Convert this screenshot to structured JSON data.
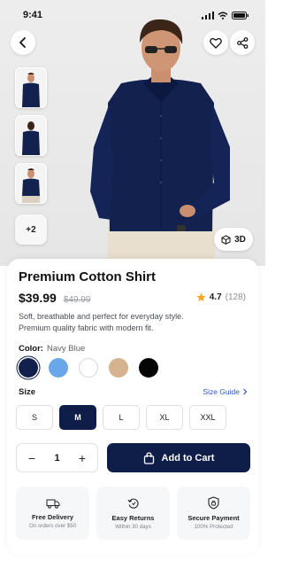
{
  "status_bar": {
    "time": "9:41"
  },
  "icons": {
    "back": "chevron-left-icon",
    "favorite": "heart-icon",
    "share": "share-icon",
    "view3d": "cube-icon"
  },
  "gallery": {
    "more_label": "+2",
    "thumb_count": 3
  },
  "view3d_label": "3D",
  "product": {
    "title": "Premium Cotton Shirt",
    "price": "$39.99",
    "old_price": "$49.99",
    "rating": "4.7",
    "reviews": "(128)",
    "desc_line1": "Soft, breathable and perfect for everyday style.",
    "desc_line2": "Premium quality fabric with modern fit."
  },
  "color": {
    "label": "Color:",
    "selected_name": "Navy Blue",
    "swatches": [
      "#12204b",
      "#6aa7ea",
      "#ffffff",
      "#d7b28f",
      "#050505"
    ],
    "selected_index": 0
  },
  "size": {
    "label": "Size",
    "guide": "Size Guide",
    "options": [
      "S",
      "M",
      "L",
      "XL",
      "XXL"
    ],
    "selected": "M"
  },
  "quantity": {
    "value": "1",
    "minus": "−",
    "plus": "+"
  },
  "cart_button": {
    "label": "Add to Cart"
  },
  "features": [
    {
      "icon": "truck-icon",
      "title": "Free Delivery",
      "subtitle": "On orders over $50"
    },
    {
      "icon": "return-icon",
      "title": "Easy Returns",
      "subtitle": "Within 30 days"
    },
    {
      "icon": "shield-icon",
      "title": "Secure Payment",
      "subtitle": "100% Protected"
    }
  ],
  "colors": {
    "brand": "#0f1e48",
    "link": "#2f56c9",
    "star": "#f5a623"
  }
}
